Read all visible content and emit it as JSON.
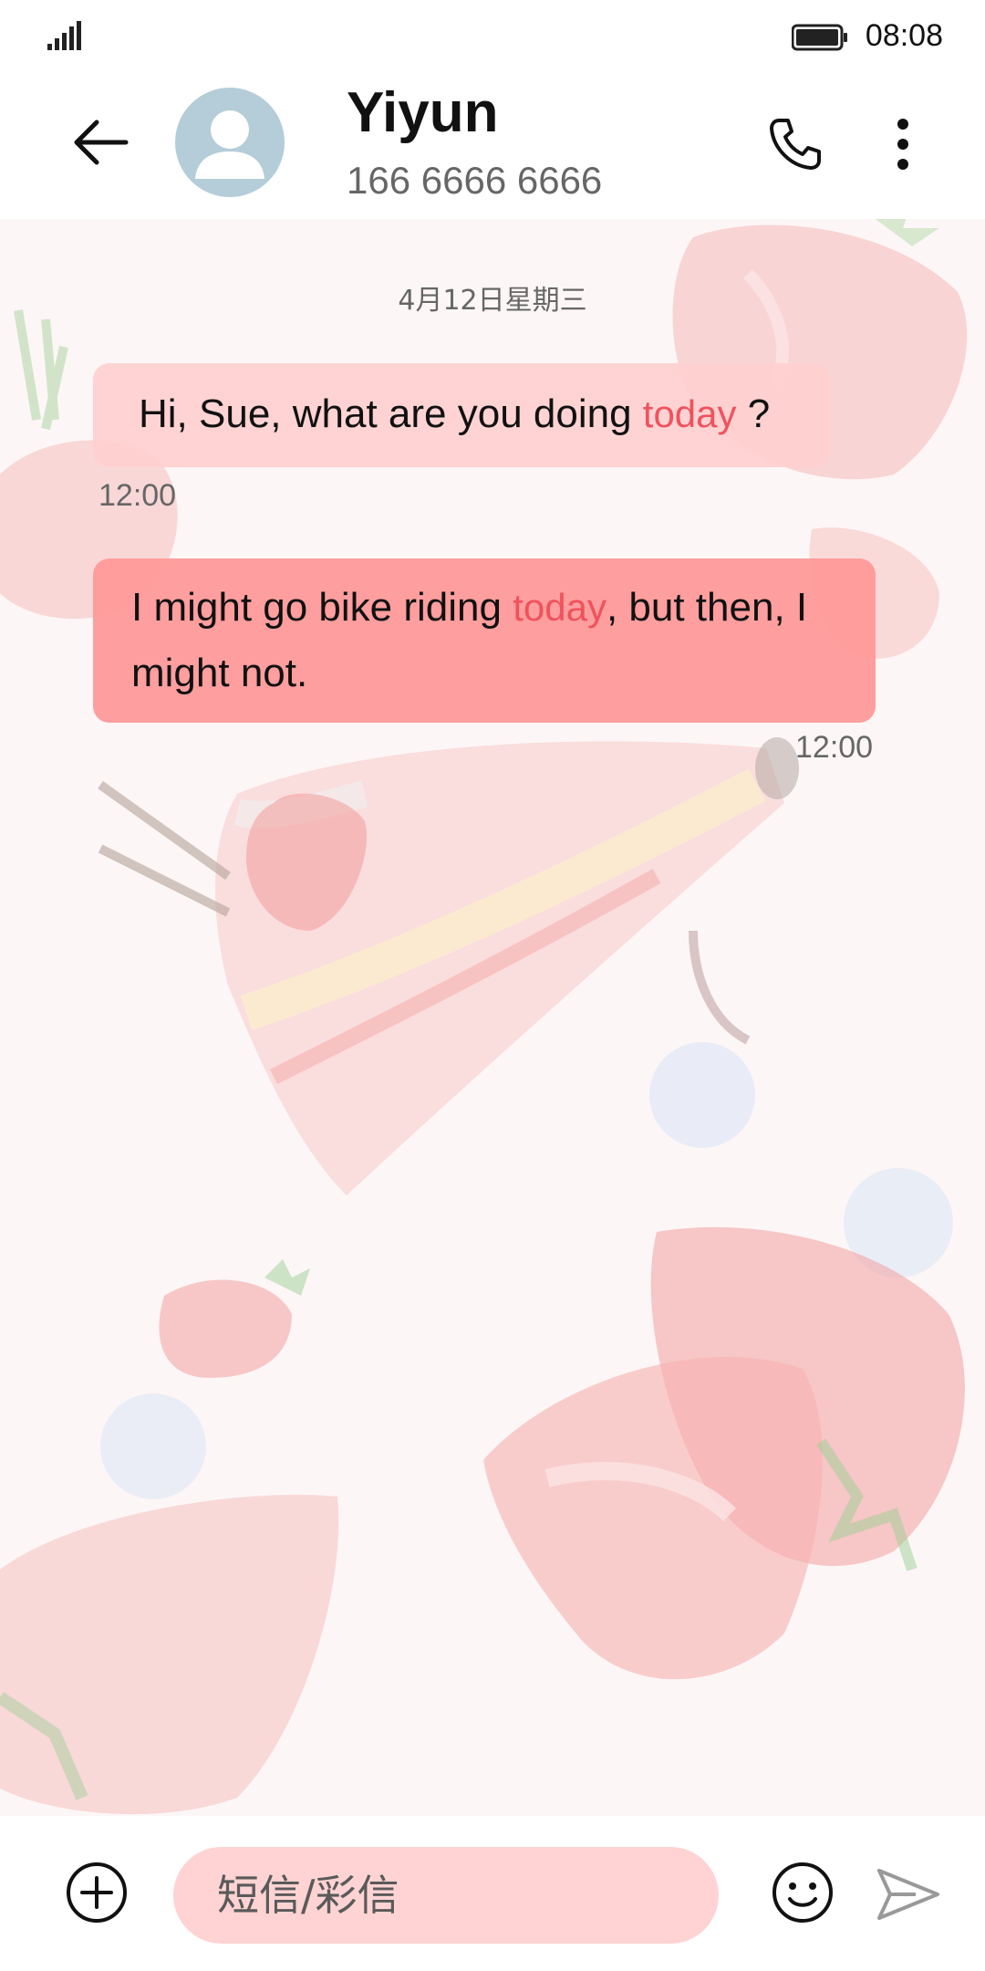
{
  "status_bar": {
    "time": "08:08",
    "signal_icon": "signal-bars-icon",
    "battery_icon": "battery-full-icon"
  },
  "header": {
    "back_icon": "back-arrow-icon",
    "avatar_icon": "person-avatar-icon",
    "contact_name": "Yiyun",
    "contact_number": "166 6666 6666",
    "call_icon": "phone-icon",
    "more_icon": "more-vertical-icon"
  },
  "conversation": {
    "date_label": "4月12日星期三",
    "messages": [
      {
        "direction": "received",
        "text_before": "Hi, Sue, what are you doing",
        "highlight": "today",
        "text_after": " ?",
        "time": "12:00"
      },
      {
        "direction": "sent",
        "text_before": "I might go bike riding ",
        "highlight": "today",
        "text_after": ", but then, I might not.",
        "time": "12:00"
      }
    ]
  },
  "composer": {
    "add_icon": "add-circle-icon",
    "placeholder": "短信/彩信",
    "emoji_icon": "emoji-icon",
    "send_icon": "send-icon"
  },
  "colors": {
    "received_bubble": "#ffcfcf",
    "sent_bubble": "#ff9b9b",
    "highlight_text": "#f0525c",
    "input_background": "#ffd3d3",
    "avatar": "#b4cdd8"
  }
}
